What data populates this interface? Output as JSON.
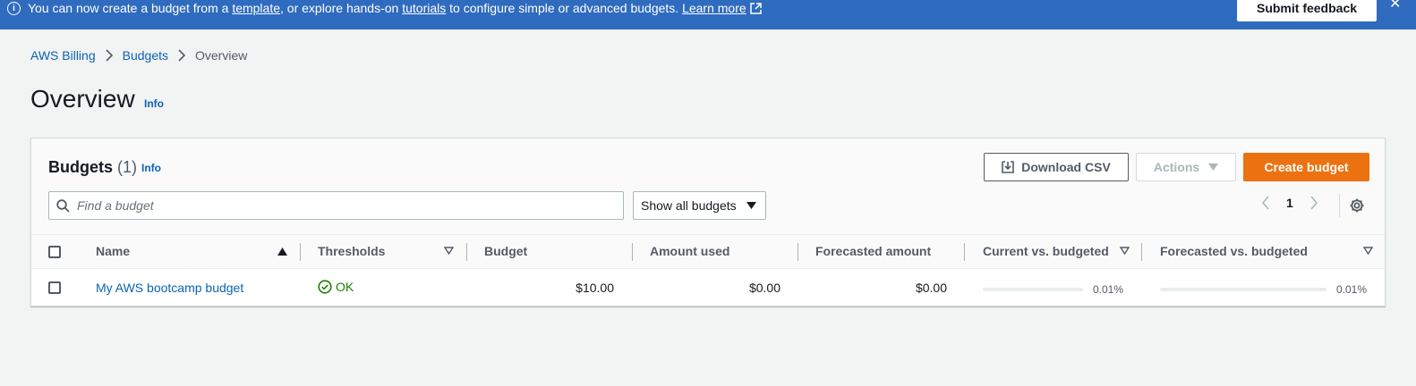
{
  "banner": {
    "prefix": "You can now create a budget from a",
    "template_link": "template",
    "middle": ", or explore hands-on",
    "tutorials_link": "tutorials",
    "suffix": "to configure simple or advanced budgets.",
    "learn_more": "Learn more",
    "feedback_label": "Submit feedback"
  },
  "breadcrumb": {
    "items": [
      "AWS Billing",
      "Budgets",
      "Overview"
    ]
  },
  "page": {
    "title": "Overview",
    "info": "Info"
  },
  "panel": {
    "title": "Budgets",
    "count": "(1)",
    "info": "Info",
    "download_label": "Download CSV",
    "actions_label": "Actions",
    "create_label": "Create budget",
    "search_placeholder": "Find a budget",
    "filter_value": "Show all budgets",
    "page_number": "1"
  },
  "table": {
    "columns": [
      "Name",
      "Thresholds",
      "Budget",
      "Amount used",
      "Forecasted amount",
      "Current vs. budgeted",
      "Forecasted vs. budgeted"
    ],
    "rows": [
      {
        "name": "My AWS bootcamp budget",
        "threshold": "OK",
        "budget": "$10.00",
        "amount_used": "$0.00",
        "forecasted": "$0.00",
        "current_vs_budgeted": "0.01%",
        "current_vs_budgeted_fraction": 0.0001,
        "forecasted_vs_budgeted": "0.01%",
        "forecasted_vs_budgeted_fraction": 0.0001
      }
    ]
  },
  "colors": {
    "banner": "#2f6bbf",
    "primary": "#ec7211",
    "link": "#0b63b6",
    "success": "#1d8102"
  }
}
